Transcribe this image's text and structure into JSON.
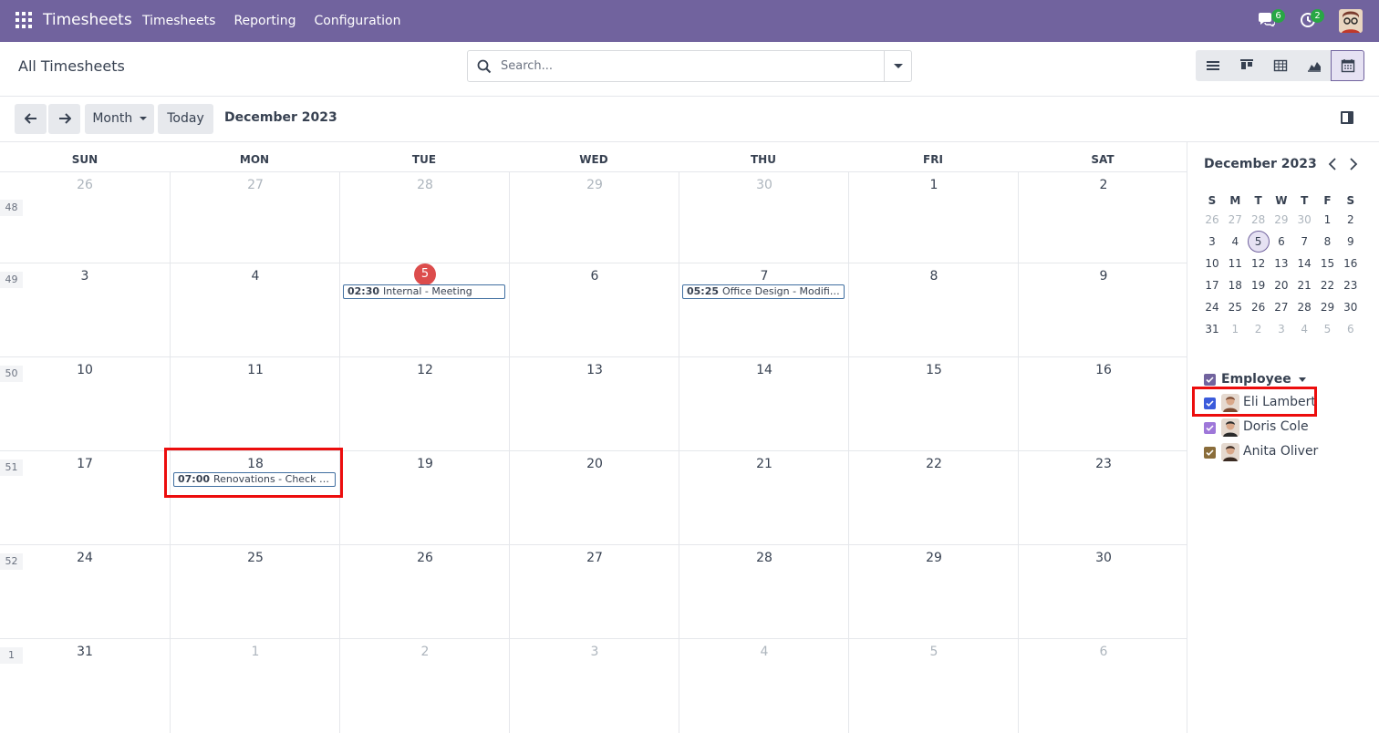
{
  "navbar": {
    "brand": "Timesheets",
    "menu": [
      "Timesheets",
      "Reporting",
      "Configuration"
    ],
    "chat_count": "6",
    "activity_count": "2",
    "color": "#71639e"
  },
  "control": {
    "title": "All Timesheets",
    "search_placeholder": "Search..."
  },
  "toolbar": {
    "scale_label": "Month",
    "today_label": "Today",
    "period_label": "December 2023"
  },
  "calendar": {
    "weekdays": [
      "SUN",
      "MON",
      "TUE",
      "WED",
      "THU",
      "FRI",
      "SAT"
    ],
    "weeks": [
      {
        "num": "48",
        "days": [
          [
            "26",
            1
          ],
          [
            "27",
            1
          ],
          [
            "28",
            1
          ],
          [
            "29",
            1
          ],
          [
            "30",
            1
          ],
          [
            "1",
            0
          ],
          [
            "2",
            0
          ]
        ]
      },
      {
        "num": "49",
        "days": [
          [
            "3",
            0
          ],
          [
            "4",
            0
          ],
          [
            "5",
            0
          ],
          [
            "6",
            0
          ],
          [
            "7",
            0
          ],
          [
            "8",
            0
          ],
          [
            "9",
            0
          ]
        ]
      },
      {
        "num": "50",
        "days": [
          [
            "10",
            0
          ],
          [
            "11",
            0
          ],
          [
            "12",
            0
          ],
          [
            "13",
            0
          ],
          [
            "14",
            0
          ],
          [
            "15",
            0
          ],
          [
            "16",
            0
          ]
        ]
      },
      {
        "num": "51",
        "days": [
          [
            "17",
            0
          ],
          [
            "18",
            0
          ],
          [
            "19",
            0
          ],
          [
            "20",
            0
          ],
          [
            "21",
            0
          ],
          [
            "22",
            0
          ],
          [
            "23",
            0
          ]
        ]
      },
      {
        "num": "52",
        "days": [
          [
            "24",
            0
          ],
          [
            "25",
            0
          ],
          [
            "26",
            0
          ],
          [
            "27",
            0
          ],
          [
            "28",
            0
          ],
          [
            "29",
            0
          ],
          [
            "30",
            0
          ]
        ]
      },
      {
        "num": "1",
        "days": [
          [
            "31",
            0
          ],
          [
            "1",
            1
          ],
          [
            "2",
            1
          ],
          [
            "3",
            1
          ],
          [
            "4",
            1
          ],
          [
            "5",
            1
          ],
          [
            "6",
            1
          ]
        ]
      }
    ],
    "events": [
      {
        "week": 1,
        "day": 2,
        "time": "02:30",
        "title": "Internal - Meeting"
      },
      {
        "week": 1,
        "day": 4,
        "time": "05:25",
        "title": "Office Design - Modifi…"
      },
      {
        "week": 3,
        "day": 1,
        "time": "07:00",
        "title": "Renovations - Check Lift"
      }
    ],
    "today": {
      "week": 1,
      "day": 2
    }
  },
  "mini_calendar": {
    "title": "December 2023",
    "heads": [
      "S",
      "M",
      "T",
      "W",
      "T",
      "F",
      "S"
    ],
    "rows": [
      [
        [
          "26",
          1
        ],
        [
          "27",
          1
        ],
        [
          "28",
          1
        ],
        [
          "29",
          1
        ],
        [
          "30",
          1
        ],
        [
          "1",
          0
        ],
        [
          "2",
          0
        ]
      ],
      [
        [
          "3",
          0
        ],
        [
          "4",
          0
        ],
        [
          "5",
          0
        ],
        [
          "6",
          0
        ],
        [
          "7",
          0
        ],
        [
          "8",
          0
        ],
        [
          "9",
          0
        ]
      ],
      [
        [
          "10",
          0
        ],
        [
          "11",
          0
        ],
        [
          "12",
          0
        ],
        [
          "13",
          0
        ],
        [
          "14",
          0
        ],
        [
          "15",
          0
        ],
        [
          "16",
          0
        ]
      ],
      [
        [
          "17",
          0
        ],
        [
          "18",
          0
        ],
        [
          "19",
          0
        ],
        [
          "20",
          0
        ],
        [
          "21",
          0
        ],
        [
          "22",
          0
        ],
        [
          "23",
          0
        ]
      ],
      [
        [
          "24",
          0
        ],
        [
          "25",
          0
        ],
        [
          "26",
          0
        ],
        [
          "27",
          0
        ],
        [
          "28",
          0
        ],
        [
          "29",
          0
        ],
        [
          "30",
          0
        ]
      ],
      [
        [
          "31",
          0
        ],
        [
          "1",
          1
        ],
        [
          "2",
          1
        ],
        [
          "3",
          1
        ],
        [
          "4",
          1
        ],
        [
          "5",
          1
        ],
        [
          "6",
          1
        ]
      ]
    ]
  },
  "filters": {
    "heading": "Employee",
    "items": [
      {
        "label": "Eli Lambert",
        "color": "#3b5bdb"
      },
      {
        "label": "Doris Cole",
        "color": "#9e77d9"
      },
      {
        "label": "Anita Oliver",
        "color": "#8a6d3b"
      }
    ]
  }
}
